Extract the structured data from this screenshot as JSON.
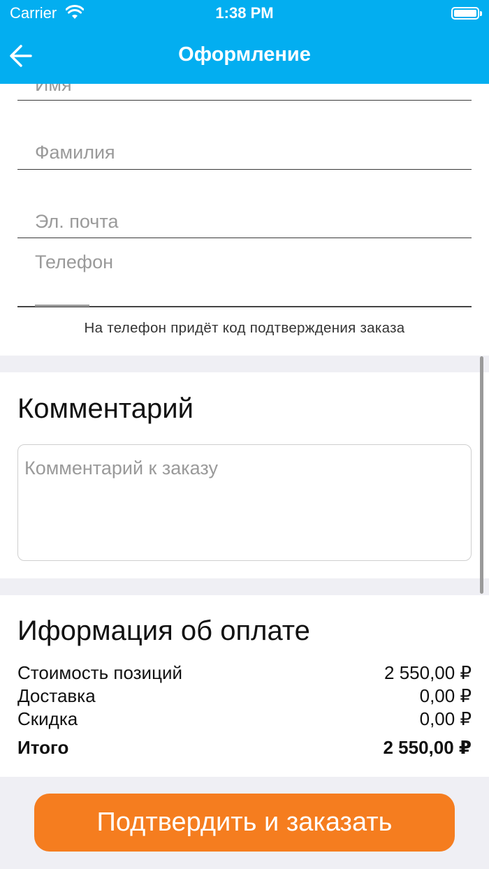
{
  "status_bar": {
    "carrier": "Carrier",
    "time": "1:38 PM"
  },
  "header": {
    "title": "Оформление",
    "back_icon": "arrow-left-icon"
  },
  "form": {
    "name_placeholder": "Имя",
    "surname_placeholder": "Фамилия",
    "email_placeholder": "Эл. почта",
    "phone_placeholder": "Телефон",
    "phone_hint": "На телефон придёт код подтверждения заказа"
  },
  "comment": {
    "title": "Комментарий",
    "placeholder": "Комментарий к заказу"
  },
  "payment": {
    "title": "Иформация об оплате",
    "rows": [
      {
        "label": "Стоимость позиций",
        "value": "2 550,00 ₽"
      },
      {
        "label": "Доставка",
        "value": "0,00 ₽"
      },
      {
        "label": "Скидка",
        "value": "0,00 ₽"
      }
    ],
    "total": {
      "label": "Итого",
      "value": "2 550,00 ₽"
    }
  },
  "confirm_button": {
    "label": "Подтвердить и заказать"
  },
  "colors": {
    "header": "#03aef0",
    "button": "#f57d1f",
    "separator": "#efeff4"
  }
}
